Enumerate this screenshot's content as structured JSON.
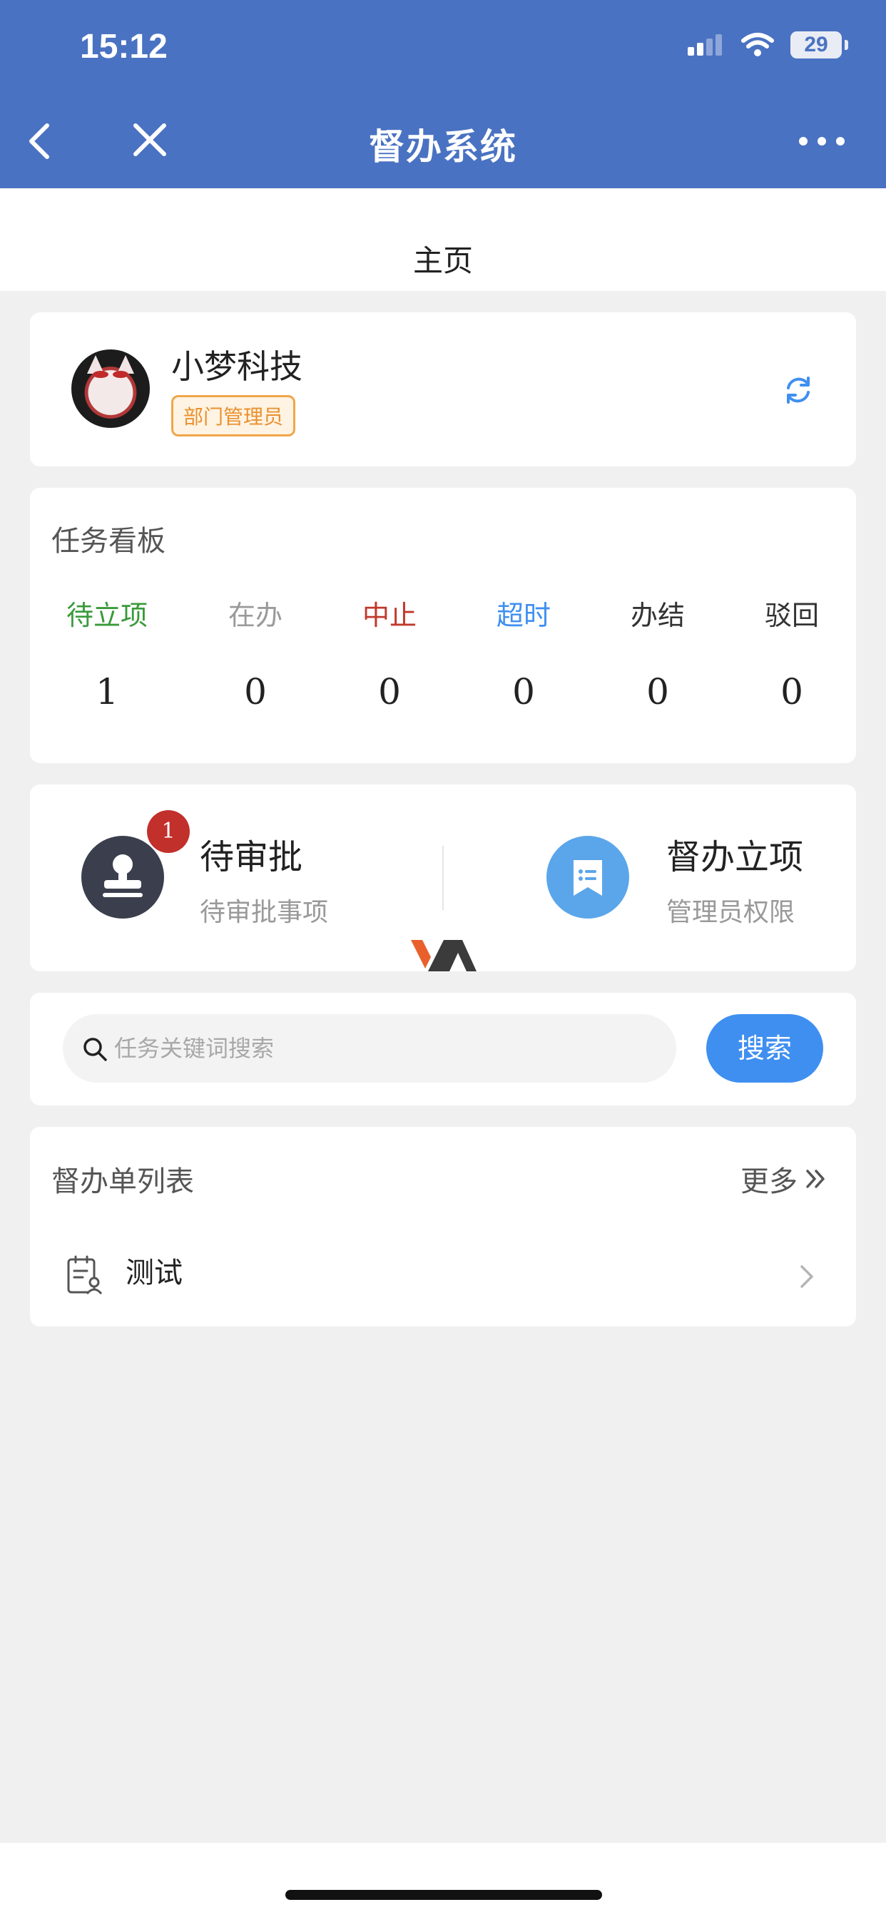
{
  "status_bar": {
    "time": "15:12",
    "battery": "29"
  },
  "nav": {
    "title": "督办系统"
  },
  "page": {
    "title": "主页"
  },
  "profile": {
    "name": "小梦科技",
    "role": "部门管理员"
  },
  "board": {
    "title": "任务看板",
    "columns": [
      {
        "label": "待立项",
        "count": "1",
        "color": "#3a9a3a"
      },
      {
        "label": "在办",
        "count": "0",
        "color": "#9a9a9a"
      },
      {
        "label": "中止",
        "count": "0",
        "color": "#c0392b"
      },
      {
        "label": "超时",
        "count": "0",
        "color": "#3f8ff0"
      },
      {
        "label": "办结",
        "count": "0",
        "color": "#333333"
      },
      {
        "label": "驳回",
        "count": "0",
        "color": "#333333"
      }
    ]
  },
  "actions": {
    "pending": {
      "title": "待审批",
      "subtitle": "待审批事项",
      "badge": "1"
    },
    "create": {
      "title": "督办立项",
      "subtitle": "管理员权限"
    }
  },
  "search": {
    "placeholder": "任务关键词搜索",
    "button": "搜索"
  },
  "list": {
    "title": "督办单列表",
    "more": "更多",
    "items": [
      {
        "label": "测试"
      }
    ]
  }
}
